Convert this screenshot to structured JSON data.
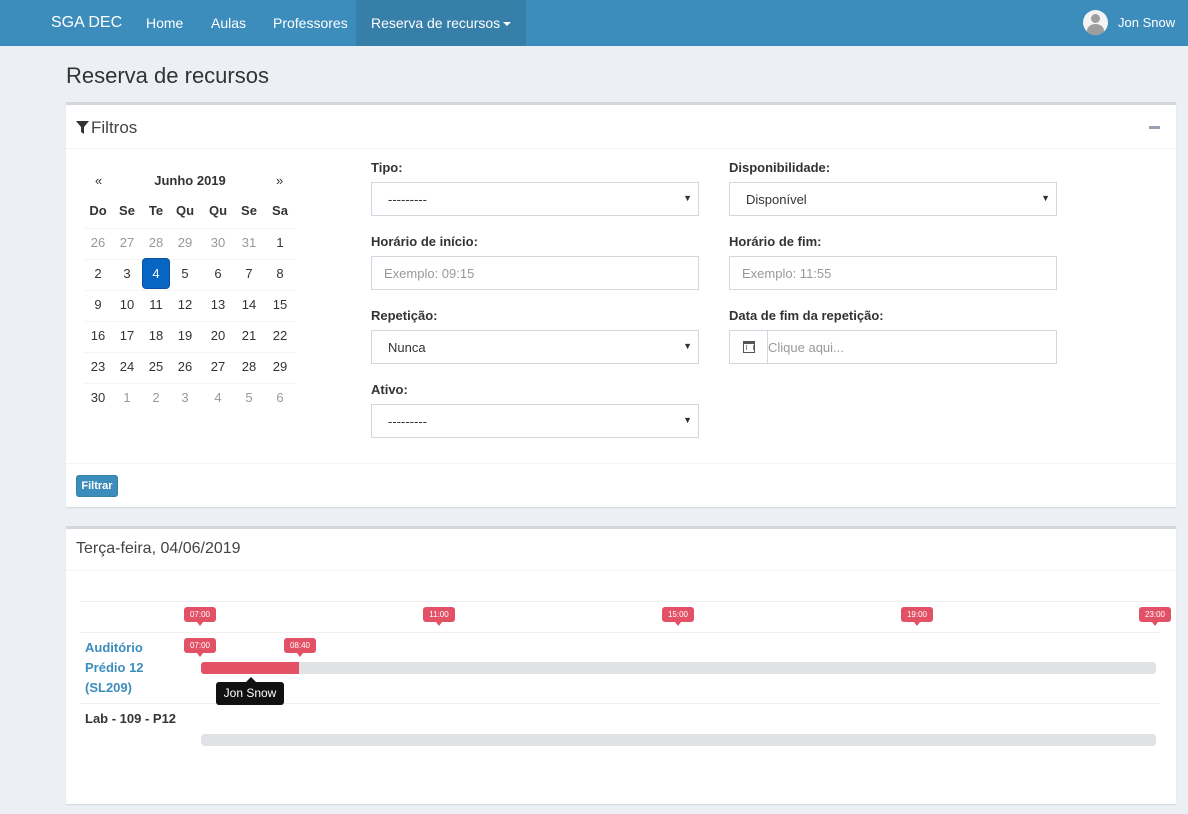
{
  "navbar": {
    "brand": "SGA DEC",
    "items": [
      "Home",
      "Aulas",
      "Professores",
      "Reserva de recursos"
    ],
    "user": "Jon Snow",
    "color": "#3c8dbc"
  },
  "page": {
    "title": "Reserva de recursos"
  },
  "filters": {
    "title": "Filtros",
    "calendar": {
      "prev": "«",
      "next": "»",
      "month": "Junho 2019",
      "weekdays": [
        "Do",
        "Se",
        "Te",
        "Qu",
        "Qu",
        "Se",
        "Sa"
      ],
      "weeks": [
        [
          "26",
          "27",
          "28",
          "29",
          "30",
          "31",
          "1"
        ],
        [
          "2",
          "3",
          "4",
          "5",
          "6",
          "7",
          "8"
        ],
        [
          "9",
          "10",
          "11",
          "12",
          "13",
          "14",
          "15"
        ],
        [
          "16",
          "17",
          "18",
          "19",
          "20",
          "21",
          "22"
        ],
        [
          "23",
          "24",
          "25",
          "26",
          "27",
          "28",
          "29"
        ],
        [
          "30",
          "1",
          "2",
          "3",
          "4",
          "5",
          "6"
        ]
      ],
      "selected_day": "4"
    },
    "tipo": {
      "label": "Tipo:",
      "value": "---------"
    },
    "disponibilidade": {
      "label": "Disponibilidade:",
      "value": "Disponível"
    },
    "horario_inicio": {
      "label": "Horário de início:",
      "placeholder": "Exemplo: 09:15"
    },
    "horario_fim": {
      "label": "Horário de fim:",
      "placeholder": "Exemplo: 11:55"
    },
    "repeticao": {
      "label": "Repetição:",
      "value": "Nunca"
    },
    "data_fim_repeticao": {
      "label": "Data de fim da repetição:",
      "placeholder": "Clique aqui..."
    },
    "ativo": {
      "label": "Ativo:",
      "value": "---------"
    },
    "submit": "Filtrar"
  },
  "schedule": {
    "title": "Terça-feira, 04/06/2019",
    "timeline_labels": [
      "07:00",
      "11:00",
      "15:00",
      "19:00",
      "23:00"
    ],
    "resources": [
      {
        "name": "Auditório Prédio 12 (SL209)",
        "bookings": [
          {
            "start": "07:00",
            "end": "08:40",
            "user": "Jon Snow"
          }
        ]
      },
      {
        "name": "Lab - 109 - P12",
        "bookings": []
      }
    ],
    "booking_color": "#e35166"
  }
}
